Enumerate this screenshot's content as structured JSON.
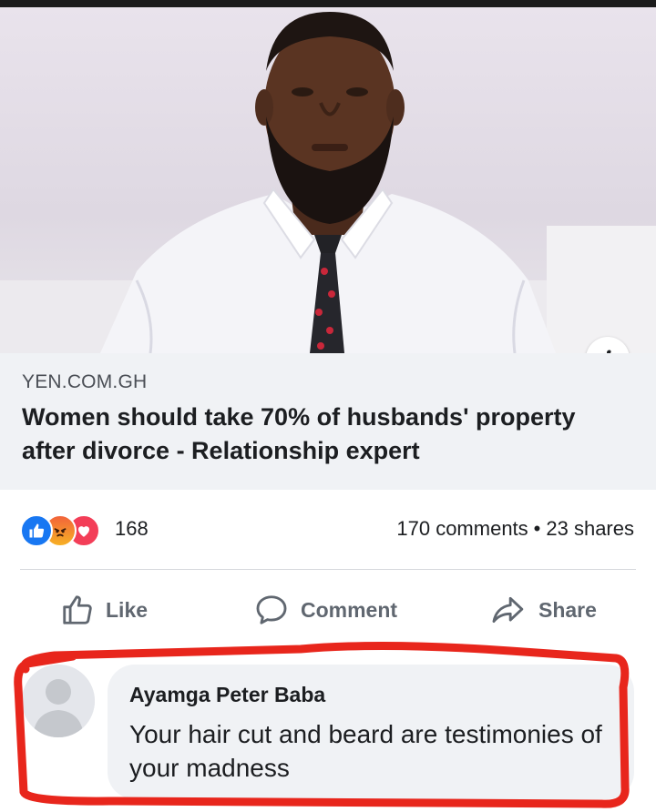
{
  "post": {
    "domain": "YEN.COM.GH",
    "headline": "Women should take 70% of husbands' property after divorce - Relationship expert"
  },
  "reactions": {
    "icons": [
      "like-icon",
      "angry-icon",
      "love-icon"
    ],
    "count": "168"
  },
  "engagement": {
    "comments": "170 comments",
    "separator": "•",
    "shares": "23 shares"
  },
  "actions": {
    "like_label": "Like",
    "comment_label": "Comment",
    "share_label": "Share"
  },
  "comment": {
    "author": "Ayamga Peter Baba",
    "text": "Your hair cut and beard are testimonies of your madness"
  },
  "colors": {
    "like_blue": "#1877f2",
    "love_red": "#f33e58",
    "annotation_red": "#e8261c",
    "action_gray": "#606770"
  }
}
